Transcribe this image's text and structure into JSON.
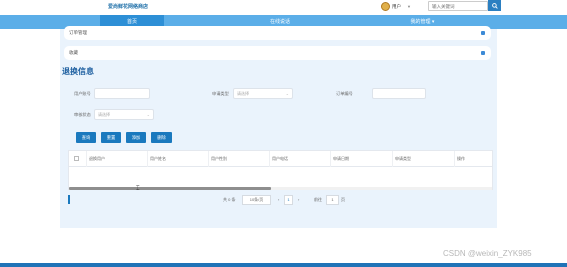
{
  "header": {
    "site_title": "爱尚鲜花网络商店",
    "user_name": "用户",
    "user_caret": "▼",
    "search_placeholder": "输入关键词",
    "colors": {
      "search_button": "#2b7fc1",
      "title": "#1e6fa8"
    }
  },
  "nav": {
    "items": [
      {
        "label": "首页"
      },
      {
        "label": "在线说话"
      },
      {
        "label": "我的管理 ▾"
      }
    ],
    "colors": {
      "bar": "#5baee8",
      "active": "#2d8fd6"
    }
  },
  "sidebar_panels": {
    "panel1": "订单管理",
    "panel2": "收藏"
  },
  "page": {
    "title": "退换信息",
    "filters": {
      "user_account_label": "用户账号",
      "user_account_value": "",
      "feedback_type_label": "申请类型",
      "feedback_type_value": "请选择",
      "order_no_label": "订单编号",
      "order_no_value": "",
      "review_status_label": "审核状态",
      "review_status_value": "请选择"
    },
    "buttons": {
      "search": "查询",
      "reset": "重置",
      "add": "添加",
      "delete": "删除"
    },
    "table": {
      "columns": [
        "退换用户",
        "用户姓名",
        "用户性别",
        "用户电话",
        "申请日期",
        "申请类型",
        "操作"
      ]
    },
    "pagination": {
      "total_label": "共 0 条",
      "page_size": "10条/页",
      "prev": "‹",
      "current_page": "1",
      "next": "›",
      "goto_label": "前往",
      "goto_value": "1",
      "page_unit": "页"
    }
  },
  "watermark": "CSDN @weixin_ZYK985"
}
